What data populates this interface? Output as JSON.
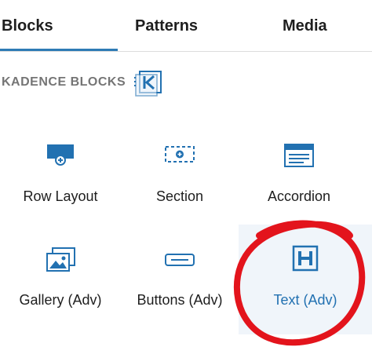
{
  "tabs": [
    {
      "label": "Blocks",
      "active": true
    },
    {
      "label": "Patterns",
      "active": false
    },
    {
      "label": "Media",
      "active": false
    }
  ],
  "section": {
    "title": "KADENCE BLOCKS",
    "logo_icon": "kadence-logo-icon"
  },
  "blocks": [
    {
      "label": "Row Layout",
      "icon": "row-layout-icon"
    },
    {
      "label": "Section",
      "icon": "section-icon"
    },
    {
      "label": "Accordion",
      "icon": "accordion-icon"
    },
    {
      "label": "Gallery (Adv)",
      "icon": "gallery-icon"
    },
    {
      "label": "Buttons (Adv)",
      "icon": "buttons-icon"
    },
    {
      "label": "Text (Adv)",
      "icon": "heading-icon",
      "highlighted": true
    }
  ],
  "colors": {
    "accent": "#2271b1",
    "tab_underline": "#2e7bb5",
    "annotation": "#e3141c",
    "highlight_bg": "#f0f5fa"
  }
}
